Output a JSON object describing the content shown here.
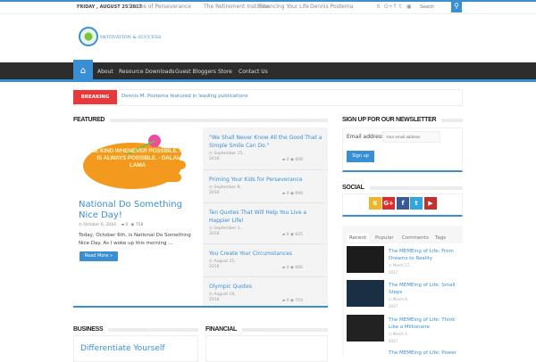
{
  "topbar": {
    "date": "FRIDAY , AUGUST 25 2017",
    "links": [
      "Stories of Perseverance",
      "The Retirement Institute",
      "Financing Your Life",
      "Dennis Postema"
    ],
    "search_placeholder": "Search"
  },
  "logo": {
    "text": "MOTIVATION & SUCCESS"
  },
  "nav": {
    "items": [
      "About",
      "Resource Downloads",
      "Guest Bloggers",
      "Store",
      "Contact Us"
    ]
  },
  "breaking": {
    "label": "BREAKING NEWS",
    "text": "Dennis M. Postema featured in leading publications"
  },
  "featured": {
    "heading": "FEATURED",
    "main": {
      "title": "National Do Something Nice Day!",
      "date": "October 6, 2016",
      "comments": "0",
      "views": "758",
      "excerpt": "Today, October 6th, is National Do Something Nice Day. As I woke up this morning ...",
      "read_more": "Read More »",
      "image_text": "BE KIND WHENEVER POSSIBLE. IT IS ALWAYS POSSIBLE. - DALAI LAMA"
    },
    "list": [
      {
        "title": "\"We Shall Never Know All the Good That a Simple Smile Can Do.\"",
        "date": "September 15, 2016",
        "comments": "0",
        "views": "608"
      },
      {
        "title": "Priming Your Kids for Perseverance",
        "date": "September 8, 2016",
        "comments": "0",
        "views": "690"
      },
      {
        "title": "Ten Quotes That Will Help You Live a Happier Life!",
        "date": "September 1, 2016",
        "comments": "0",
        "views": "625"
      },
      {
        "title": "You Create Your Circumstances",
        "date": "August 25, 2016",
        "comments": "0",
        "views": "666"
      },
      {
        "title": "Olympic Quotes",
        "date": "August 18, 2016",
        "comments": "0",
        "views": "710"
      }
    ]
  },
  "newsletter": {
    "heading": "SIGN UP FOR OUR NEWSLETTER",
    "email_label": "Email address",
    "email_placeholder": "Your email address",
    "button": "Sign up"
  },
  "social": {
    "heading": "SOCIAL",
    "icons": [
      {
        "name": "rss",
        "glyph": "દ",
        "color": "#f0b429"
      },
      {
        "name": "google-plus",
        "glyph": "G+",
        "color": "#dd2d2d"
      },
      {
        "name": "facebook",
        "glyph": "f",
        "color": "#3b5998"
      },
      {
        "name": "twitter",
        "glyph": "t",
        "color": "#2fa6df"
      },
      {
        "name": "youtube",
        "glyph": "▶",
        "color": "#c4302b"
      }
    ]
  },
  "tabs": {
    "labels": [
      "Recent",
      "Popular",
      "Comments",
      "Tags"
    ],
    "recent": [
      {
        "title": "The MEMEing of Life: From Dreams to Reality",
        "date": "March 17, 2017"
      },
      {
        "title": "The MEMEing of Life: Small Steps",
        "date": "March 8, 2017"
      },
      {
        "title": "The MEMEing of Life: Think Like a Millionaire",
        "date": "March 1, 2017"
      },
      {
        "title": "The MEMEing of Life: Power",
        "date": ""
      }
    ]
  },
  "sections": {
    "business": "BUSINESS",
    "financial": "FINANCIAL",
    "business_post": "Differentiate Yourself"
  },
  "colors": {
    "accent": "#3a8fd3",
    "breaking": "#e8393a",
    "nav": "#2d2d2d"
  }
}
